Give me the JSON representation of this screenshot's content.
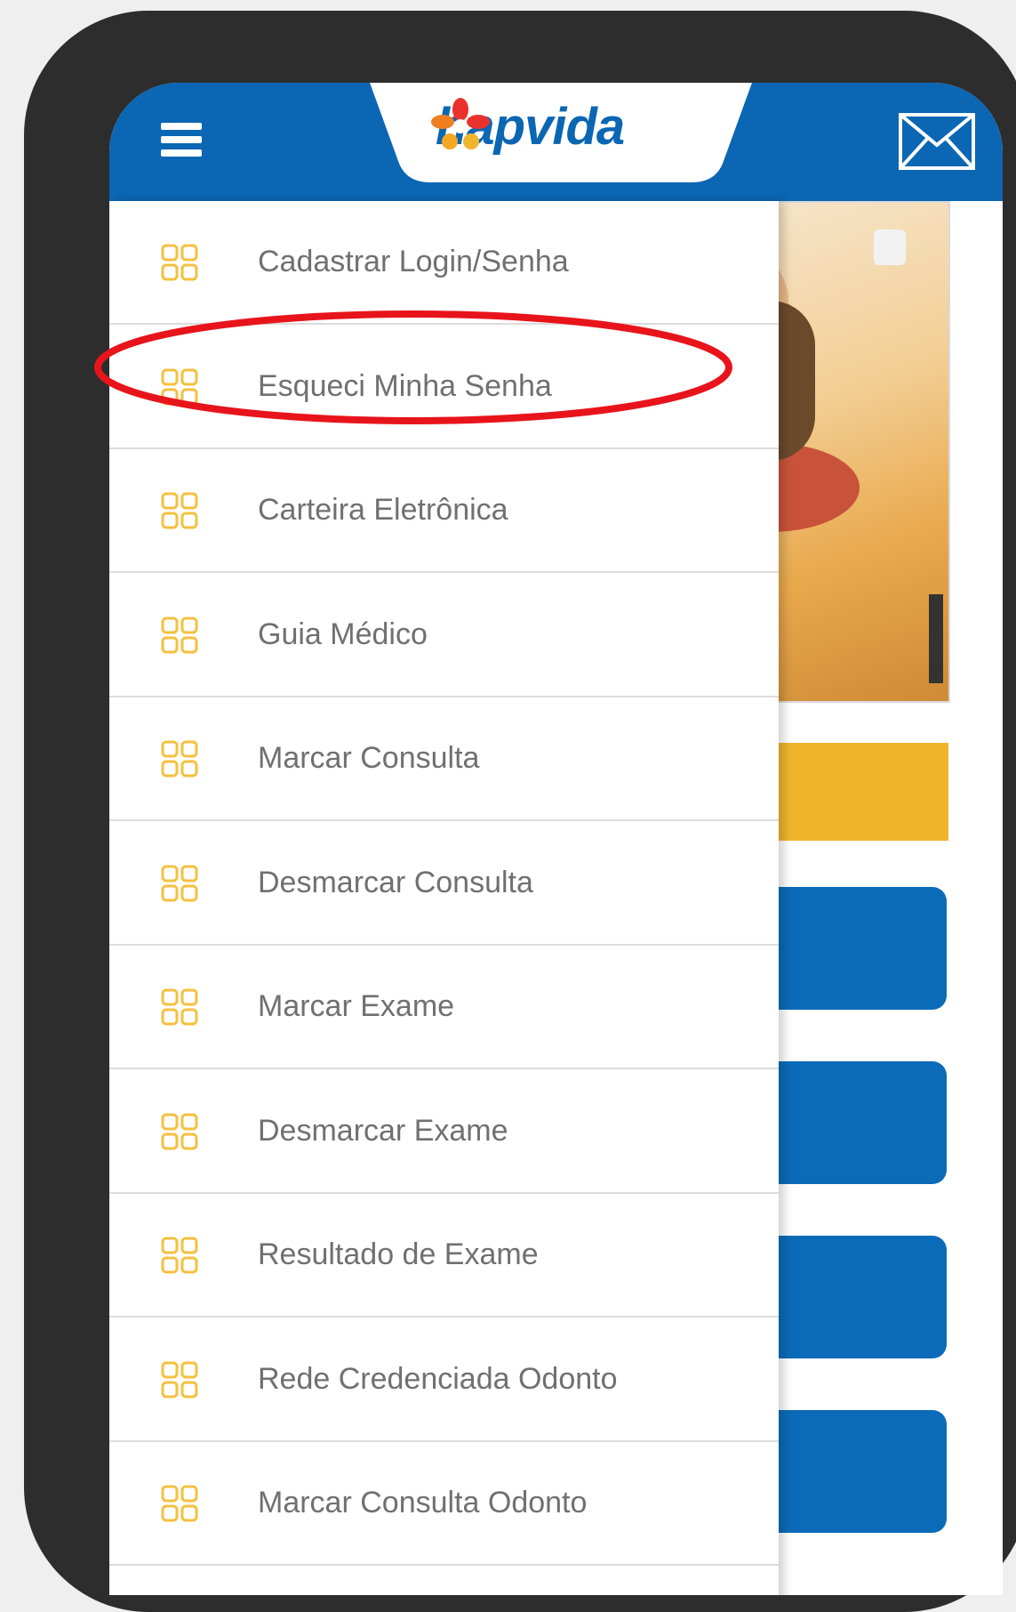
{
  "header": {
    "logo_text": "hapvida",
    "menu_icon": "hamburger-menu-icon",
    "mail_icon": "envelope-icon",
    "brand_color": "#0b66b3",
    "accent_color": "#f0b52c"
  },
  "drawer": {
    "icon": "grid-icon",
    "items": [
      {
        "label": "Cadastrar Login/Senha"
      },
      {
        "label": "Esqueci Minha Senha"
      },
      {
        "label": "Carteira Eletrônica"
      },
      {
        "label": "Guia Médico"
      },
      {
        "label": "Marcar Consulta"
      },
      {
        "label": "Desmarcar Consulta"
      },
      {
        "label": "Marcar Exame"
      },
      {
        "label": "Desmarcar Exame"
      },
      {
        "label": "Resultado de Exame"
      },
      {
        "label": "Rede Credenciada Odonto"
      },
      {
        "label": "Marcar Consulta Odonto"
      }
    ]
  },
  "annotation": {
    "highlight_color": "#e8141b"
  }
}
